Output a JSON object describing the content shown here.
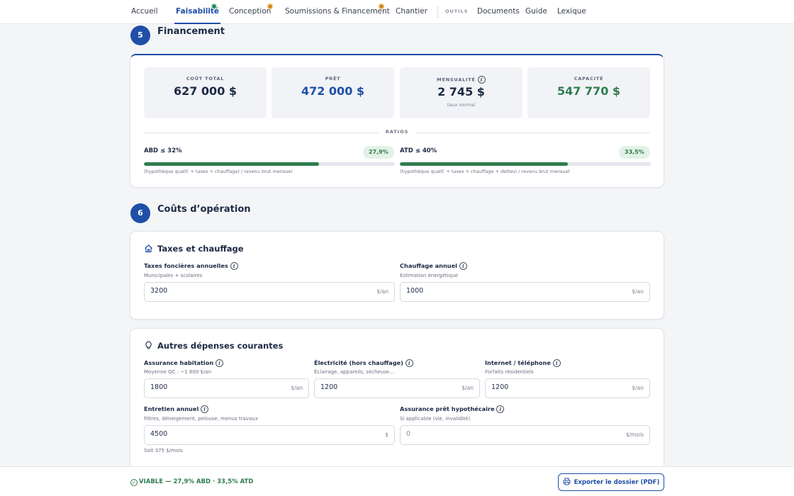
{
  "nav": {
    "items": [
      {
        "label": "Accueil"
      },
      {
        "label": "Faisabilité"
      },
      {
        "label": "Conception"
      },
      {
        "label": "Soumissions & Financement"
      },
      {
        "label": "Chantier"
      }
    ],
    "group_label": "OUTILS",
    "tools": [
      {
        "label": "Documents"
      },
      {
        "label": "Guide"
      },
      {
        "label": "Lexique"
      }
    ]
  },
  "section5": {
    "number": "5",
    "title": "Financement",
    "stats": [
      {
        "label": "COÛT TOTAL",
        "value": "627 000 $",
        "color": "#1d2a44"
      },
      {
        "label": "PRÊT",
        "value": "472 000 $",
        "color": "#1f4fa8"
      },
      {
        "label": "MENSUALITÉ",
        "value": "2 745 $",
        "sub": "taux normal",
        "color": "#1d2a44"
      },
      {
        "label": "CAPACITÉ",
        "value": "547 770 $",
        "color": "#2e7d4f"
      }
    ],
    "ratios_label": "RATIOS",
    "ratios": [
      {
        "name": "ABD ≤ 32%",
        "value": "27,9%",
        "fill": 0.697,
        "desc": "(hypothèque qualif. + taxes + chauffage) / revenu brut mensuel"
      },
      {
        "name": "ATD ≤ 40%",
        "value": "33,5%",
        "fill": 0.669,
        "desc": "(hypothèque qualif. + taxes + chauffage + dettes) / revenu brut mensuel"
      }
    ]
  },
  "section6": {
    "number": "6",
    "title": "Coûts d’opération",
    "taxes_card": {
      "title": "Taxes et chauffage",
      "fields": [
        {
          "label": "Taxes foncières annuelles",
          "sub": "Municipales + scolaires",
          "value": "3200",
          "unit": "$/an"
        },
        {
          "label": "Chauffage annuel",
          "sub": "Estimation énergétique",
          "value": "1000",
          "unit": "$/an"
        }
      ]
    },
    "other_card": {
      "title": "Autres dépenses courantes",
      "fields": [
        {
          "label": "Assurance habitation",
          "sub": "Moyenne QC : ~1 800 $/an",
          "value": "1800",
          "unit": "$/an"
        },
        {
          "label": "Électricité (hors chauffage)",
          "sub": "Éclairage, appareils, sécheuse…",
          "value": "1200",
          "unit": "$/an"
        },
        {
          "label": "Internet / téléphone",
          "sub": "Forfaits résidentiels",
          "value": "1200",
          "unit": "$/an"
        },
        {
          "label": "Entretien annuel",
          "sub": "Filtres, déneigement, pelouse, menus travaux",
          "value": "4500",
          "unit": "$",
          "note": "Soit 375 $/mois"
        },
        {
          "label": "Assurance prêt hypothécaire",
          "sub": "Si applicable (vie, invalidité)",
          "value": "",
          "placeholder": "0",
          "unit": "$/mois"
        }
      ]
    }
  },
  "footer": {
    "status": "VIABLE — 27,9% ABD · 33,5% ATD",
    "export_label": "Exporter le dossier (PDF)"
  },
  "colors": {
    "accent": "#1f4fa8",
    "success": "#2e7d4f",
    "warning": "#d48a1a"
  }
}
